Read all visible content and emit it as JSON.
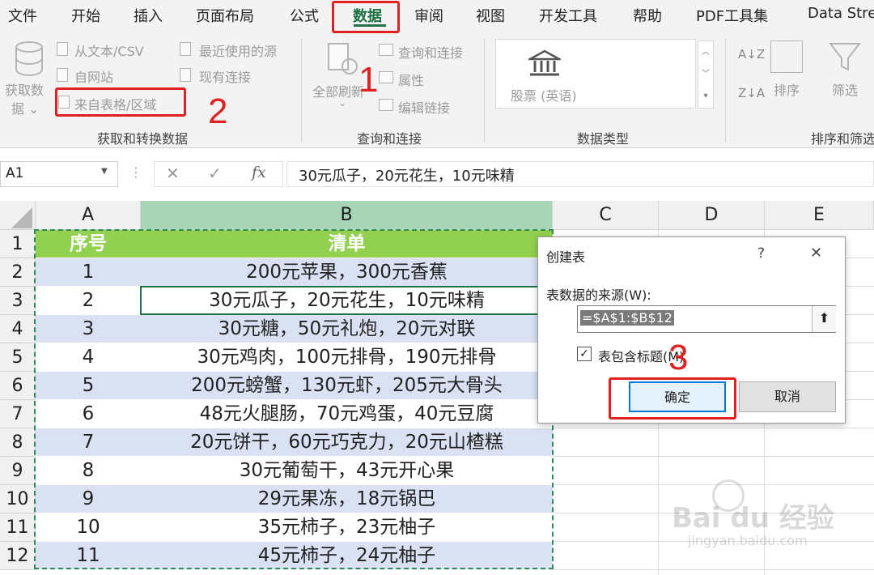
{
  "tabs": [
    "文件",
    "开始",
    "插入",
    "页面布局",
    "公式",
    "数据",
    "审阅",
    "视图",
    "开发工具",
    "帮助",
    "PDF工具集",
    "Data Stre"
  ],
  "ribbon": {
    "get_data": "获取数",
    "get_data2": "据 ⌄",
    "from_text": "从文本/CSV",
    "from_web": "自网站",
    "from_table": "来自表格/区域",
    "recent_sources": "最近使用的源",
    "existing_conn": "现有连接",
    "group1": "获取和转换数据",
    "refresh_all": "全部刷新",
    "query_conn": "查询和连接",
    "properties": "属性",
    "edit_links": "编辑链接",
    "group2": "查询和连接",
    "stocks": "股票 (英语)",
    "group3": "数据类型",
    "sort": "排序",
    "filter": "筛选",
    "group4": "排序和筛选"
  },
  "formula_bar": {
    "name_box": "A1",
    "content": "30元瓜子，20元花生，10元味精"
  },
  "columns": [
    "A",
    "B",
    "C",
    "D",
    "E"
  ],
  "rows": [
    {
      "n": "1",
      "a": "序号",
      "b": "清单"
    },
    {
      "n": "2",
      "a": "1",
      "b": "200元苹果，300元香蕉"
    },
    {
      "n": "3",
      "a": "2",
      "b": "30元瓜子，20元花生，10元味精"
    },
    {
      "n": "4",
      "a": "3",
      "b": "30元糖，50元礼炮，20元对联"
    },
    {
      "n": "5",
      "a": "4",
      "b": "30元鸡肉，100元排骨，190元排骨"
    },
    {
      "n": "6",
      "a": "5",
      "b": "200元螃蟹，130元虾，205元大骨头"
    },
    {
      "n": "7",
      "a": "6",
      "b": "48元火腿肠，70元鸡蛋，40元豆腐"
    },
    {
      "n": "8",
      "a": "7",
      "b": "20元饼干，60元巧克力，20元山楂糕"
    },
    {
      "n": "9",
      "a": "8",
      "b": "30元葡萄干，43元开心果"
    },
    {
      "n": "10",
      "a": "9",
      "b": "29元果冻，18元锅巴"
    },
    {
      "n": "11",
      "a": "10",
      "b": "35元柿子，23元柚子"
    },
    {
      "n": "12",
      "a": "11",
      "b": "45元柿子，24元柚子"
    }
  ],
  "dialog": {
    "title": "创建表",
    "help": "?",
    "close": "✕",
    "source_label": "表数据的来源(W):",
    "source_value": "=$A$1:$B$12",
    "has_headers": "表包含标题(M)",
    "ok": "确定",
    "cancel": "取消"
  },
  "annotations": {
    "n1": "1",
    "n2": "2",
    "n3": "3"
  },
  "watermark": {
    "brand": "Bai du 经验",
    "url": "jingyan.baidu.com"
  },
  "colors": {
    "header_green": "#92d050",
    "band_blue": "#d9e1f2",
    "excel_green": "#217346",
    "annotation_red": "#e02020"
  }
}
